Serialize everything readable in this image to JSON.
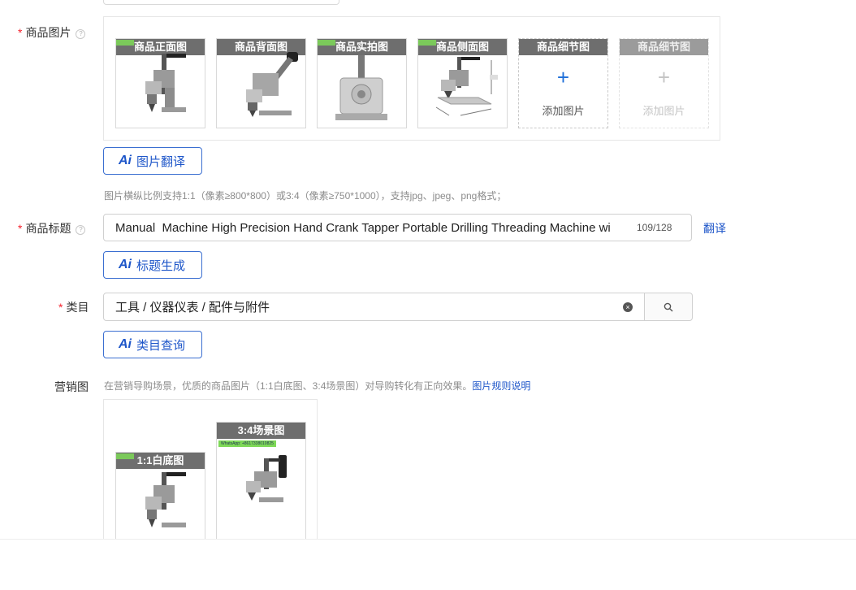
{
  "product_images": {
    "label": "商品图片",
    "help": "?",
    "thumbs": [
      {
        "caption": "商品正面图"
      },
      {
        "caption": "商品背面图"
      },
      {
        "caption": "商品实拍图"
      },
      {
        "caption": "商品侧面图"
      }
    ],
    "add_slots": [
      {
        "caption": "商品细节图",
        "add_text": "添加图片",
        "plus": "+"
      },
      {
        "caption": "商品细节图",
        "add_text": "添加图片",
        "plus": "+"
      }
    ],
    "ai_button": {
      "ai": "Ai",
      "label": "图片翻译"
    },
    "hint": "图片横纵比例支持1:1（像素≥800*800）或3:4（像素≥750*1000），支持jpg、jpeg、png格式；"
  },
  "product_title": {
    "label": "商品标题",
    "help": "?",
    "value": "Manual  Machine High Precision Hand Crank Tapper Portable Drilling Threading Machine wi",
    "count": "109/128",
    "translate_link": "翻译",
    "ai_button": {
      "ai": "Ai",
      "label": "标题生成"
    }
  },
  "category": {
    "label": "类目",
    "value": "工具 / 仪器仪表 / 配件与附件",
    "clear_glyph": "×",
    "ai_button": {
      "ai": "Ai",
      "label": "类目查询"
    }
  },
  "marketing": {
    "label": "营销图",
    "hint": "在营销导购场景，优质的商品图片（1:1白底图、3:4场景图）对导购转化有正向效果。",
    "rules_link": "图片规则说明",
    "thumbs": [
      {
        "caption": "1:1白底图"
      },
      {
        "caption": "3:4场景图"
      }
    ],
    "watermark_text": "WhatsApp: +8617338010825"
  },
  "colors": {
    "accent": "#1e56c9",
    "required": "#f5222d",
    "caption_bg": "#6e6e6e"
  }
}
